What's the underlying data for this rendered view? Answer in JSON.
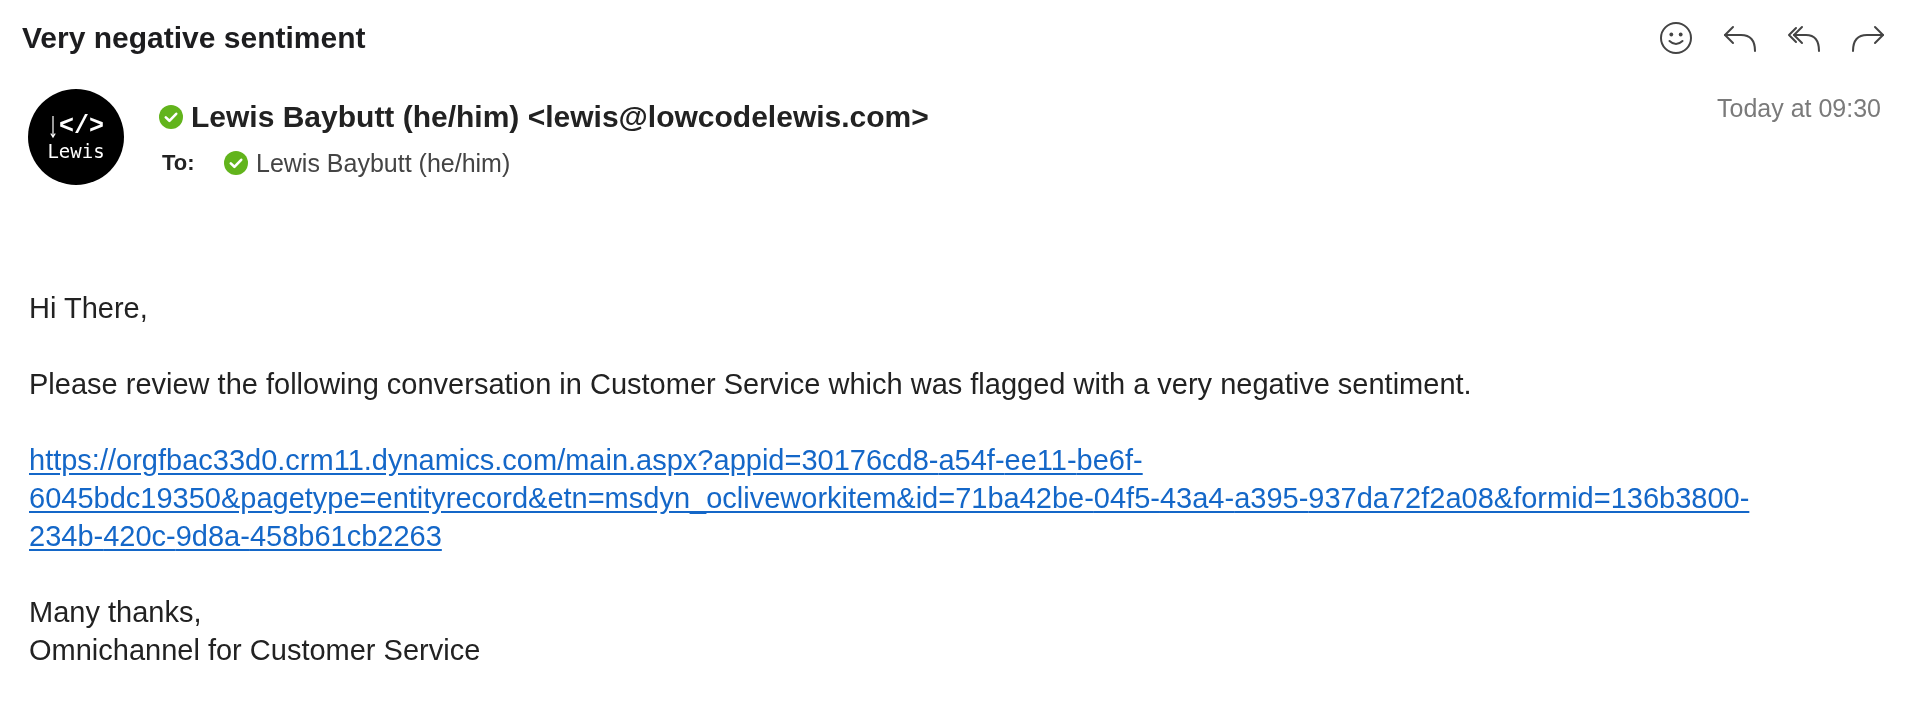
{
  "message": {
    "subject": "Very negative sentiment",
    "avatar": {
      "code": "</>",
      "name": "Lewis"
    },
    "sender": "Lewis Baybutt (he/him) <lewis@lowcodelewis.com>",
    "to_label": "To:",
    "recipients": [
      "Lewis Baybutt (he/him)"
    ],
    "date": "Today at 09:30"
  },
  "body": [
    {
      "kind": "text",
      "lines": [
        "Hi There,"
      ]
    },
    {
      "kind": "text",
      "lines": [
        "Please review the following conversation in Customer Service which was flagged with a very negative sentiment."
      ]
    },
    {
      "kind": "link",
      "lines": [
        "https://orgfbac33d0.crm11.dynamics.com/main.aspx?appid=30176cd8-a54f-ee11-be6f-6045bdc19350&pagetype=entityrecord&etn=msdyn_ocliveworkitem&id=71ba42be-04f5-43a4-a395-937da72f2a08&formid=136b3800-234b-420c-9d8a-458b61cb2263"
      ]
    },
    {
      "kind": "text",
      "lines": [
        "Many thanks,",
        "Omnichannel for Customer Service"
      ]
    }
  ]
}
